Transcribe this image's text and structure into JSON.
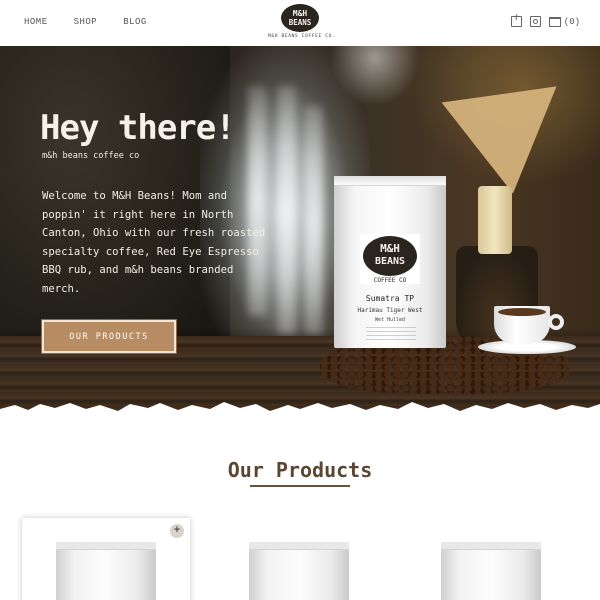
{
  "header": {
    "nav": [
      "HOME",
      "SHOP",
      "BLOG"
    ],
    "logo_text": [
      "M&H",
      "BEANS"
    ],
    "tagline": "M&H BEANS COFFEE CO.",
    "social_icons": [
      "facebook-icon",
      "instagram-icon"
    ],
    "cart_count": "(0)"
  },
  "hero": {
    "title": "Hey there!",
    "subtitle": "m&h beans coffee co",
    "body": "Welcome to M&H Beans! Mom and poppin' it right here in North Canton, Ohio with our fresh roasted specialty coffee, Red Eye Espresso BBQ rub, and m&h beans branded merch.",
    "cta_label": "OUR PRODUCTS",
    "bag": {
      "logo_lines": [
        "M&H",
        "BEANS",
        "COFFEE CO"
      ],
      "name": "Sumatra TP",
      "variety": "Harimau Tiger West",
      "process": "Wet Hulled"
    }
  },
  "products": {
    "heading": "Our Products",
    "plus_label": "+"
  },
  "colors": {
    "accent": "#b88c62",
    "text_dark": "#5a4632",
    "hero_text": "#f4f1ea"
  }
}
